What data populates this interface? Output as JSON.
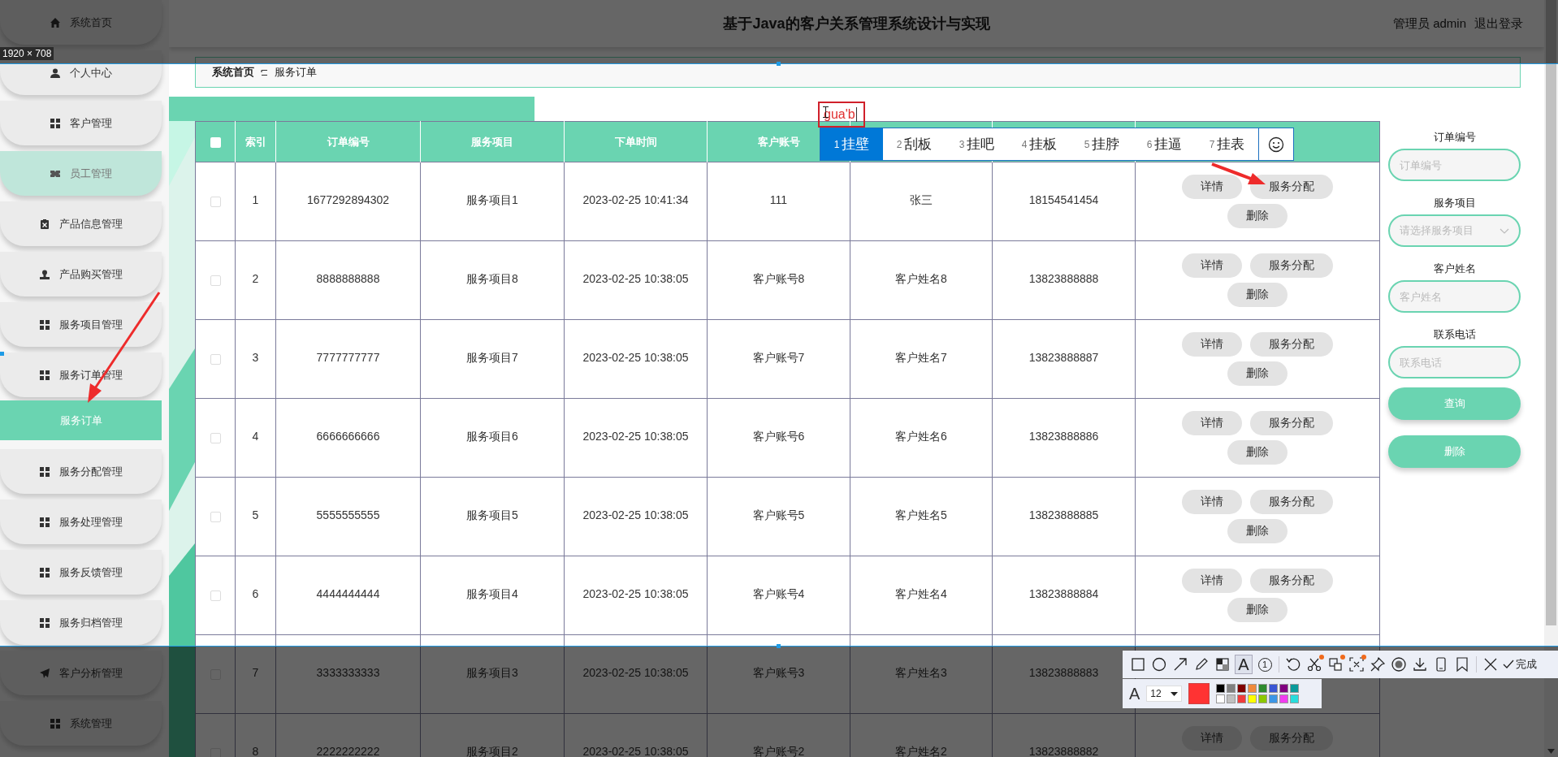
{
  "sidebar": {
    "items": [
      {
        "label": "系统首页",
        "kind": "menu",
        "selected": false,
        "highlighted": false
      },
      {
        "label": "个人中心",
        "kind": "menu",
        "selected": false,
        "highlighted": false
      },
      {
        "label": "客户管理",
        "kind": "menu",
        "selected": false,
        "highlighted": false
      },
      {
        "label": "员工管理",
        "kind": "menu",
        "selected": false,
        "highlighted": true
      },
      {
        "label": "产品信息管理",
        "kind": "menu",
        "selected": false,
        "highlighted": false
      },
      {
        "label": "产品购买管理",
        "kind": "menu",
        "selected": false,
        "highlighted": false
      },
      {
        "label": "服务项目管理",
        "kind": "menu",
        "selected": false,
        "highlighted": false
      },
      {
        "label": "服务订单管理",
        "kind": "menu",
        "selected": false,
        "highlighted": false
      },
      {
        "label": "服务订单",
        "kind": "submenu",
        "selected": true,
        "highlighted": false
      },
      {
        "label": "服务分配管理",
        "kind": "menu",
        "selected": false,
        "highlighted": false
      },
      {
        "label": "服务处理管理",
        "kind": "menu",
        "selected": false,
        "highlighted": false
      },
      {
        "label": "服务反馈管理",
        "kind": "menu",
        "selected": false,
        "highlighted": false
      },
      {
        "label": "服务归档管理",
        "kind": "menu",
        "selected": false,
        "highlighted": false
      },
      {
        "label": "客户分析管理",
        "kind": "menu",
        "selected": false,
        "highlighted": false
      },
      {
        "label": "系统管理",
        "kind": "menu",
        "selected": false,
        "highlighted": false
      }
    ]
  },
  "header": {
    "title": "基于Java的客户关系管理系统设计与实现",
    "user": "管理员 admin",
    "logout": "退出登录"
  },
  "breadcrumb": [
    "系统首页",
    "服务订单"
  ],
  "table": {
    "header_checkbox": {
      "checked": false
    },
    "columns": [
      "索引",
      "订单编号",
      "服务项目",
      "下单时间",
      "客户账号"
    ],
    "rows": [
      {
        "checked": false,
        "cells": [
          "1",
          "1677292894302",
          "服务项目1",
          "2023-02-25 10:41:34",
          "111",
          "张三",
          "18154541454"
        ],
        "actions": [
          "详情",
          "服务分配",
          "删除"
        ]
      },
      {
        "checked": false,
        "cells": [
          "2",
          "8888888888",
          "服务项目8",
          "2023-02-25 10:38:05",
          "客户账号8",
          "客户姓名8",
          "13823888888"
        ],
        "actions": [
          "详情",
          "服务分配",
          "删除"
        ]
      },
      {
        "checked": false,
        "cells": [
          "3",
          "7777777777",
          "服务项目7",
          "2023-02-25 10:38:05",
          "客户账号7",
          "客户姓名7",
          "13823888887"
        ],
        "actions": [
          "详情",
          "服务分配",
          "删除"
        ]
      },
      {
        "checked": false,
        "cells": [
          "4",
          "6666666666",
          "服务项目6",
          "2023-02-25 10:38:05",
          "客户账号6",
          "客户姓名6",
          "13823888886"
        ],
        "actions": [
          "详情",
          "服务分配",
          "删除"
        ]
      },
      {
        "checked": false,
        "cells": [
          "5",
          "5555555555",
          "服务项目5",
          "2023-02-25 10:38:05",
          "客户账号5",
          "客户姓名5",
          "13823888885"
        ],
        "actions": [
          "详情",
          "服务分配",
          "删除"
        ]
      },
      {
        "checked": false,
        "cells": [
          "6",
          "4444444444",
          "服务项目4",
          "2023-02-25 10:38:05",
          "客户账号4",
          "客户姓名4",
          "13823888884"
        ],
        "actions": [
          "详情",
          "服务分配",
          "删除"
        ]
      },
      {
        "checked": false,
        "cells": [
          "7",
          "3333333333",
          "服务项目3",
          "2023-02-25 10:38:05",
          "客户账号3",
          "客户姓名3",
          "13823888883"
        ]
      },
      {
        "checked": false,
        "cells": [
          "8",
          "2222222222",
          "服务项目2",
          "2023-02-25 10:38:05",
          "客户账号2",
          "客户姓名2",
          "13823888882"
        ],
        "actions": [
          "详情",
          "服务分配"
        ]
      }
    ]
  },
  "search": {
    "fields": [
      {
        "label": "订单编号",
        "placeholder": "订单编号",
        "kind": "input"
      },
      {
        "label": "服务项目",
        "placeholder": "请选择服务项目",
        "kind": "select"
      },
      {
        "label": "客户姓名",
        "placeholder": "客户姓名",
        "kind": "input"
      },
      {
        "label": "联系电话",
        "placeholder": "联系电话",
        "kind": "input"
      }
    ],
    "buttons": [
      "查询",
      "删除"
    ]
  },
  "screenshot_tool": {
    "size_label": "1920 × 708",
    "ime": {
      "composition": "gua'b",
      "candidates": [
        {
          "number": "1",
          "text": "挂壁",
          "selected": true
        },
        {
          "number": "2",
          "text": "刮板",
          "selected": false
        },
        {
          "number": "3",
          "text": "挂吧",
          "selected": false
        },
        {
          "number": "4",
          "text": "挂板",
          "selected": false
        },
        {
          "number": "5",
          "text": "挂脖",
          "selected": false
        },
        {
          "number": "6",
          "text": "挂逼",
          "selected": false
        },
        {
          "number": "7",
          "text": "挂表",
          "selected": false
        }
      ]
    },
    "toolbar": {
      "tools": [
        {
          "selected": false,
          "badge": false
        },
        {
          "selected": false,
          "badge": false
        },
        {
          "selected": false,
          "badge": false
        },
        {
          "selected": false,
          "badge": false
        },
        {
          "selected": false,
          "badge": false
        },
        {
          "selected": true,
          "badge": false,
          "glyph": "A"
        },
        {
          "selected": false,
          "badge": false,
          "glyph": "1"
        },
        {
          "selected": false,
          "badge": false
        },
        {
          "selected": false,
          "badge": true
        },
        {
          "selected": false,
          "badge": true
        },
        {
          "selected": false,
          "badge": true
        },
        {
          "selected": false,
          "badge": false
        },
        {
          "selected": false,
          "badge": false
        },
        {
          "selected": false,
          "badge": false
        },
        {
          "selected": false,
          "badge": false
        },
        {
          "selected": false,
          "badge": false
        },
        {
          "selected": false,
          "badge": false
        }
      ],
      "done": "完成",
      "font_glyph": "A",
      "font_size": "12",
      "current_swatch": {
        "color": "#ff3333"
      },
      "palette": [
        {
          "color": "#000000"
        },
        {
          "color": "#808080"
        },
        {
          "color": "#800000"
        },
        {
          "color": "#f08a3c"
        },
        {
          "color": "#2e8b2e"
        },
        {
          "color": "#3a56d4"
        },
        {
          "color": "#800080"
        },
        {
          "color": "#0a9a9a"
        },
        {
          "color": "#ffffff"
        },
        {
          "color": "#c0c0c0"
        },
        {
          "color": "#f03c3c"
        },
        {
          "color": "#ffff00"
        },
        {
          "color": "#8cc800"
        },
        {
          "color": "#3c96e6"
        },
        {
          "color": "#f03cf0"
        },
        {
          "color": "#28dcdc"
        }
      ]
    }
  }
}
